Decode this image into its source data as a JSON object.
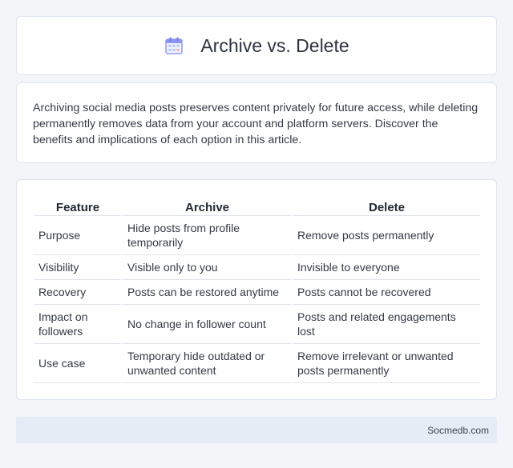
{
  "header": {
    "title": "Archive vs. Delete",
    "icon": "calendar-icon"
  },
  "intro": {
    "text": "Archiving social media posts preserves content privately for future access, while deleting permanently removes data from your account and platform servers. Discover the benefits and implications of each option in this article."
  },
  "table": {
    "headers": [
      "Feature",
      "Archive",
      "Delete"
    ],
    "rows": [
      [
        "Purpose",
        "Hide posts from profile temporarily",
        "Remove posts permanently"
      ],
      [
        "Visibility",
        "Visible only to you",
        "Invisible to everyone"
      ],
      [
        "Recovery",
        "Posts can be restored anytime",
        "Posts cannot be recovered"
      ],
      [
        "Impact on followers",
        "No change in follower count",
        "Posts and related engagements lost"
      ],
      [
        "Use case",
        "Temporary hide outdated or unwanted content",
        "Remove irrelevant or unwanted posts permanently"
      ]
    ]
  },
  "footer": {
    "site": "Socmedb.com"
  },
  "colors": {
    "background": "#f3f5f9",
    "card": "#ffffff",
    "footer": "#e6ecf6",
    "icon_accent": "#7b8cf0"
  }
}
